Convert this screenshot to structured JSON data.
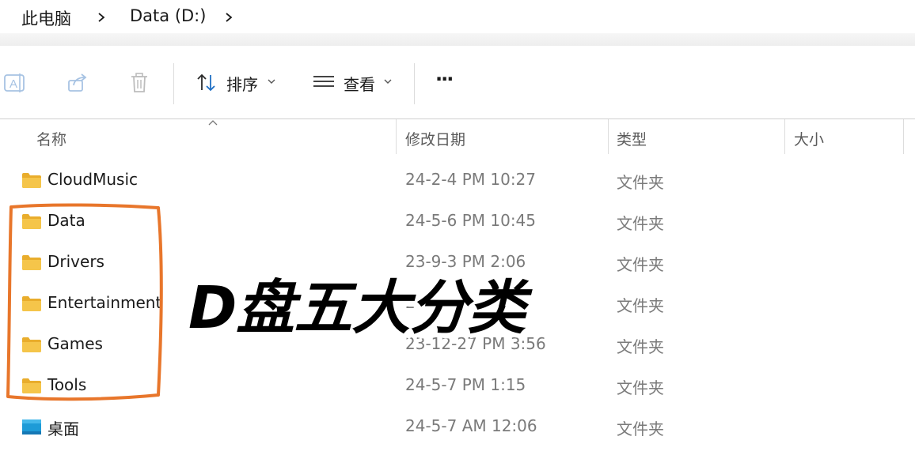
{
  "breadcrumb": {
    "root": "此电脑",
    "drive": "Data (D:)"
  },
  "toolbar": {
    "sort_label": "排序",
    "view_label": "查看",
    "more_label": "···"
  },
  "columns": {
    "name": "名称",
    "modified": "修改日期",
    "type": "类型",
    "size": "大小"
  },
  "items": [
    {
      "name": "CloudMusic",
      "modified": "24-2-4 PM 10:27",
      "type": "文件夹",
      "icon": "folder-icon"
    },
    {
      "name": "Data",
      "modified": "24-5-6 PM 10:45",
      "type": "文件夹",
      "icon": "folder-icon"
    },
    {
      "name": "Drivers",
      "modified": "23-9-3 PM 2:06",
      "type": "文件夹",
      "icon": "folder-icon"
    },
    {
      "name": "Entertainment",
      "modified": "23-12-",
      "type": "文件夹",
      "icon": "folder-icon"
    },
    {
      "name": "Games",
      "modified": "23-12-27 PM 3:56",
      "type": "文件夹",
      "icon": "folder-icon"
    },
    {
      "name": "Tools",
      "modified": "24-5-7 PM 1:15",
      "type": "文件夹",
      "icon": "folder-icon"
    },
    {
      "name": "桌面",
      "modified": "24-5-7 AM 12:06",
      "type": "文件夹",
      "icon": "desktop-folder-icon"
    }
  ],
  "overlay": {
    "title": "D盘五大分类"
  },
  "colors": {
    "annotation": "#e8762b",
    "folder": "#f5c54a",
    "desktop_folder": "#1e9bd7"
  }
}
